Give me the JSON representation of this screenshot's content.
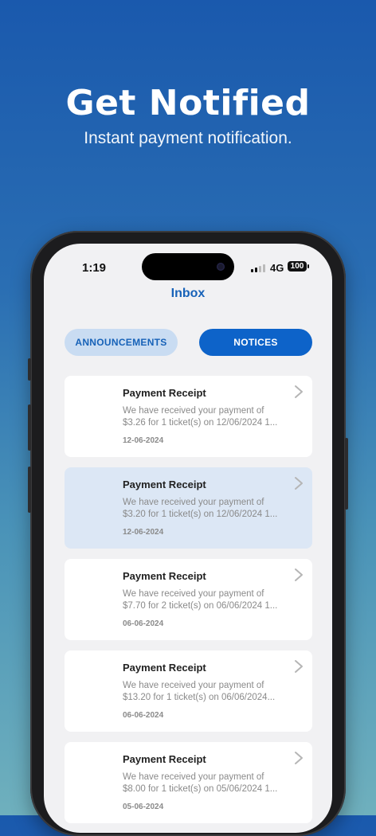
{
  "hero": {
    "title": "Get Notified",
    "subtitle": "Instant payment notification."
  },
  "status_bar": {
    "time": "1:19",
    "network": "4G",
    "battery": "100"
  },
  "inbox": {
    "title": "Inbox",
    "tabs": [
      {
        "label": "ANNOUNCEMENTS",
        "active": false
      },
      {
        "label": "NOTICES",
        "active": true
      }
    ],
    "notices": [
      {
        "title": "Payment Receipt",
        "line1": "We have received your payment of",
        "line2": "$3.26 for 1 ticket(s) on 12/06/2024 1...",
        "date": "12-06-2024",
        "highlighted": false
      },
      {
        "title": "Payment Receipt",
        "line1": "We have received your payment of",
        "line2": "$3.20 for 1 ticket(s) on 12/06/2024 1...",
        "date": "12-06-2024",
        "highlighted": true
      },
      {
        "title": "Payment Receipt",
        "line1": "We have received your payment of",
        "line2": "$7.70 for 2 ticket(s) on 06/06/2024 1...",
        "date": "06-06-2024",
        "highlighted": false
      },
      {
        "title": "Payment Receipt",
        "line1": "We have received your payment of",
        "line2": "$13.20 for 1 ticket(s) on 06/06/2024...",
        "date": "06-06-2024",
        "highlighted": false
      },
      {
        "title": "Payment Receipt",
        "line1": "We have received your payment of",
        "line2": "$8.00 for 1 ticket(s) on 05/06/2024 1...",
        "date": "05-06-2024",
        "highlighted": false
      }
    ]
  },
  "colors": {
    "accent": "#0d63c9",
    "highlight": "#dce7f5"
  }
}
